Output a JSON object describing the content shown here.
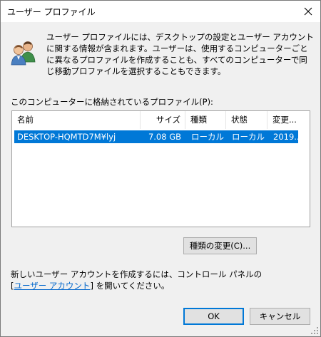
{
  "window": {
    "title": "ユーザー プロファイル"
  },
  "description": {
    "text": "ユーザー プロファイルには、デスクトップの設定とユーザー アカウントに関する情報が含まれます。ユーザーは、使用するコンピューターごとに異なるプロファイルを作成することも、すべてのコンピューターで同じ移動プロファイルを選択することもできます。"
  },
  "profiles": {
    "label": "このコンピューターに格納されているプロファイル(P):",
    "columns": {
      "name": "名前",
      "size": "サイズ",
      "type": "種類",
      "status": "状態",
      "modified": "変更..."
    },
    "rows": [
      {
        "name": "DESKTOP-HQMTD7M¥lyj",
        "size": "7.08 GB",
        "type": "ローカル",
        "status": "ローカル",
        "modified": "2019..."
      }
    ]
  },
  "buttons": {
    "change_type": "種類の変更(C)...",
    "ok": "OK",
    "cancel": "キャンセル"
  },
  "footer": {
    "line1": "新しいユーザー アカウントを作成するには、コントロール パネルの",
    "bracket_open": "[",
    "link": "ユーザー アカウント",
    "line2_rest": "] を開いてください。"
  },
  "icons": {
    "users": "users-icon",
    "close": "close-icon",
    "grip": "resize-grip-icon"
  },
  "colors": {
    "selection": "#0078d7",
    "link": "#0066cc",
    "dialog_bg": "#f0f0f0"
  }
}
